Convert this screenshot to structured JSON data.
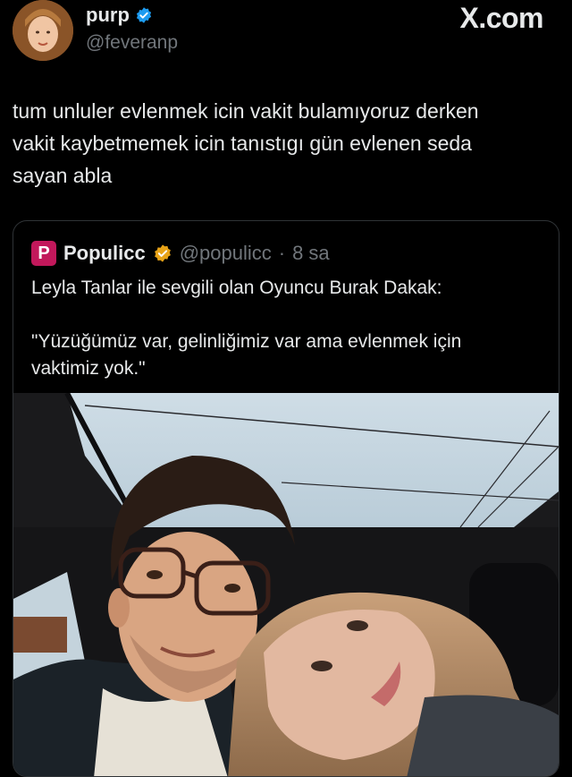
{
  "header": {
    "display_name": "purp",
    "handle": "@feveranp",
    "source_mark": "X.com"
  },
  "tweet": {
    "text": "tum unluler evlenmek icin vakit bulamıyoruz derken\nvakit kaybetmemek icin tanıstıgı gün evlenen seda\nsayan abla"
  },
  "quote": {
    "logo_letter": "P",
    "name": "Populicc",
    "handle": "@populicc",
    "separator": "·",
    "time": "8 sa",
    "text": "Leyla Tanlar ile sevgili olan Oyuncu Burak Dakak:\n\n\"Yüzüğümüz var, gelinliğimiz var ama evlenmek için\nvaktimiz yok.\"",
    "logo_color": "#c2185b",
    "badge_color": "#e8a317"
  },
  "colors": {
    "background": "#000000",
    "text_primary": "#e7e9ea",
    "text_secondary": "#71767b",
    "verified_blue": "#1d9bf0",
    "border": "#2f3336"
  },
  "icons": {
    "verified": "verified-badge-icon",
    "gold_badge": "gold-verified-badge-icon"
  }
}
